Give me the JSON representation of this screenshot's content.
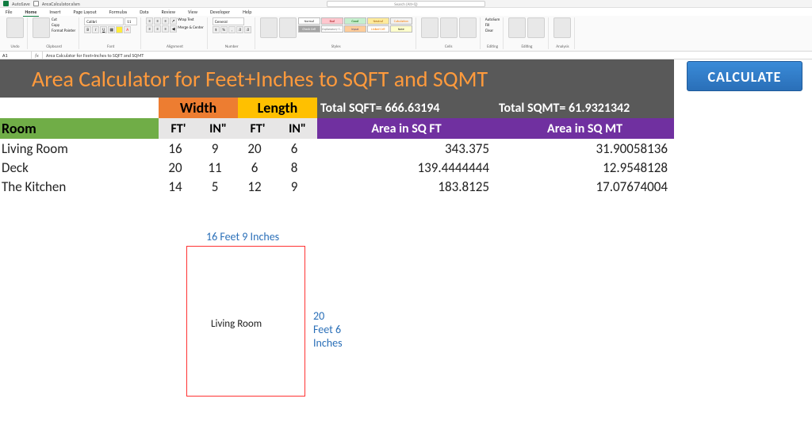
{
  "titlebar": {
    "autosave": "AutoSave",
    "filename": "AreaCalculator.xlsm",
    "search_placeholder": "Search (Alt+Q)"
  },
  "menu": [
    "File",
    "Home",
    "Insert",
    "Page Layout",
    "Formulas",
    "Data",
    "Review",
    "View",
    "Developer",
    "Help"
  ],
  "ribbon": {
    "paste": "Paste",
    "cut": "Cut",
    "copy": "Copy",
    "painter": "Format Painter",
    "clipboard": "Clipboard",
    "font_name": "Calibri",
    "font_size": "11",
    "font": "Font",
    "wrap": "Wrap Text",
    "merge": "Merge & Center",
    "alignment": "Alignment",
    "numfmt": "General",
    "number": "Number",
    "cond": "Conditional Formatting",
    "fmttable": "Format as Table",
    "styles_lbl": "Styles",
    "style_normal": "Normal",
    "style_bad": "Bad",
    "style_good": "Good",
    "style_neutral": "Neutral",
    "style_calc": "Calculation",
    "style_check": "Check Cell",
    "style_expl": "Explanatory T...",
    "style_input": "Input",
    "style_linked": "Linked Cell",
    "style_note": "Note",
    "insert": "Insert",
    "delete": "Delete",
    "format": "Format",
    "cells": "Cells",
    "autosum": "AutoSum",
    "fill": "Fill",
    "clear": "Clear",
    "sort": "Sort & Filter",
    "find": "Find & Select",
    "editing": "Editing",
    "analyze": "Analyze Data",
    "analysis": "Analysis",
    "undo": "Undo"
  },
  "fbar": {
    "cell": "A1",
    "val": "Area Calculator for Feet+Inches to SQFT and SQMT"
  },
  "sheet": {
    "title": "Area Calculator for Feet+Inches to SQFT and SQMT",
    "calc_btn": "CALCULATE",
    "hdr_width": "Width",
    "hdr_length": "Length",
    "hdr_total_sqft": "Total SQFT= 666.63194",
    "hdr_total_sqmt": "Total SQMT= 61.9321342",
    "hdr_room": "Room",
    "hdr_ft": "FT'",
    "hdr_in": "IN\"",
    "hdr_area_ft": "Area in SQ FT",
    "hdr_area_mt": "Area in SQ MT",
    "rows": [
      {
        "name": "Living Room",
        "wf": "16",
        "wi": "9",
        "lf": "20",
        "li": "6",
        "sqft": "343.375",
        "sqmt": "31.90058136"
      },
      {
        "name": "Deck",
        "wf": "20",
        "wi": "11",
        "lf": "6",
        "li": "8",
        "sqft": "139.4444444",
        "sqmt": "12.9548128"
      },
      {
        "name": "The Kitchen",
        "wf": "14",
        "wi": "5",
        "lf": "12",
        "li": "9",
        "sqft": "183.8125",
        "sqmt": "17.07674004"
      }
    ],
    "diagram": {
      "width_label": "16 Feet 9 Inches",
      "height_label": "20 Feet 6 Inches",
      "room_name": "Living Room"
    }
  }
}
